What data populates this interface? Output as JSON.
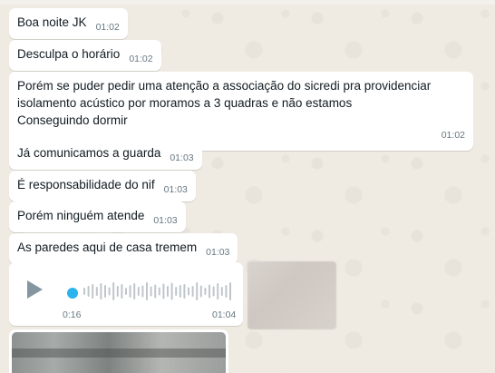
{
  "messages": [
    {
      "text": "Boa noite JK",
      "time": "01:02"
    },
    {
      "text": "Desculpa o horário",
      "time": "01:02"
    },
    {
      "text": "Porém se puder pedir uma atenção a associação do sicredi pra providenciar\nisolamento acústico por moramos a 3 quadras e não estamos\nConseguindo dormir",
      "time": "01:02"
    },
    {
      "text": "Já comunicamos a guarda",
      "time": "01:03"
    },
    {
      "text": "É responsabilidade do nif",
      "time": "01:03"
    },
    {
      "text": "Porém ninguém atende",
      "time": "01:03"
    },
    {
      "text": "As paredes aqui de casa tremem",
      "time": "01:03"
    }
  ],
  "audio": {
    "current_time": "0:16",
    "duration": "01:04",
    "progress": 0.0
  },
  "icons": {
    "play": "play-icon"
  },
  "colors": {
    "background": "#efeae2",
    "bubble": "#ffffff",
    "text": "#111b21",
    "timestamp": "#667781",
    "audio_dot": "#2ab3ec",
    "play": "#8696a0"
  }
}
